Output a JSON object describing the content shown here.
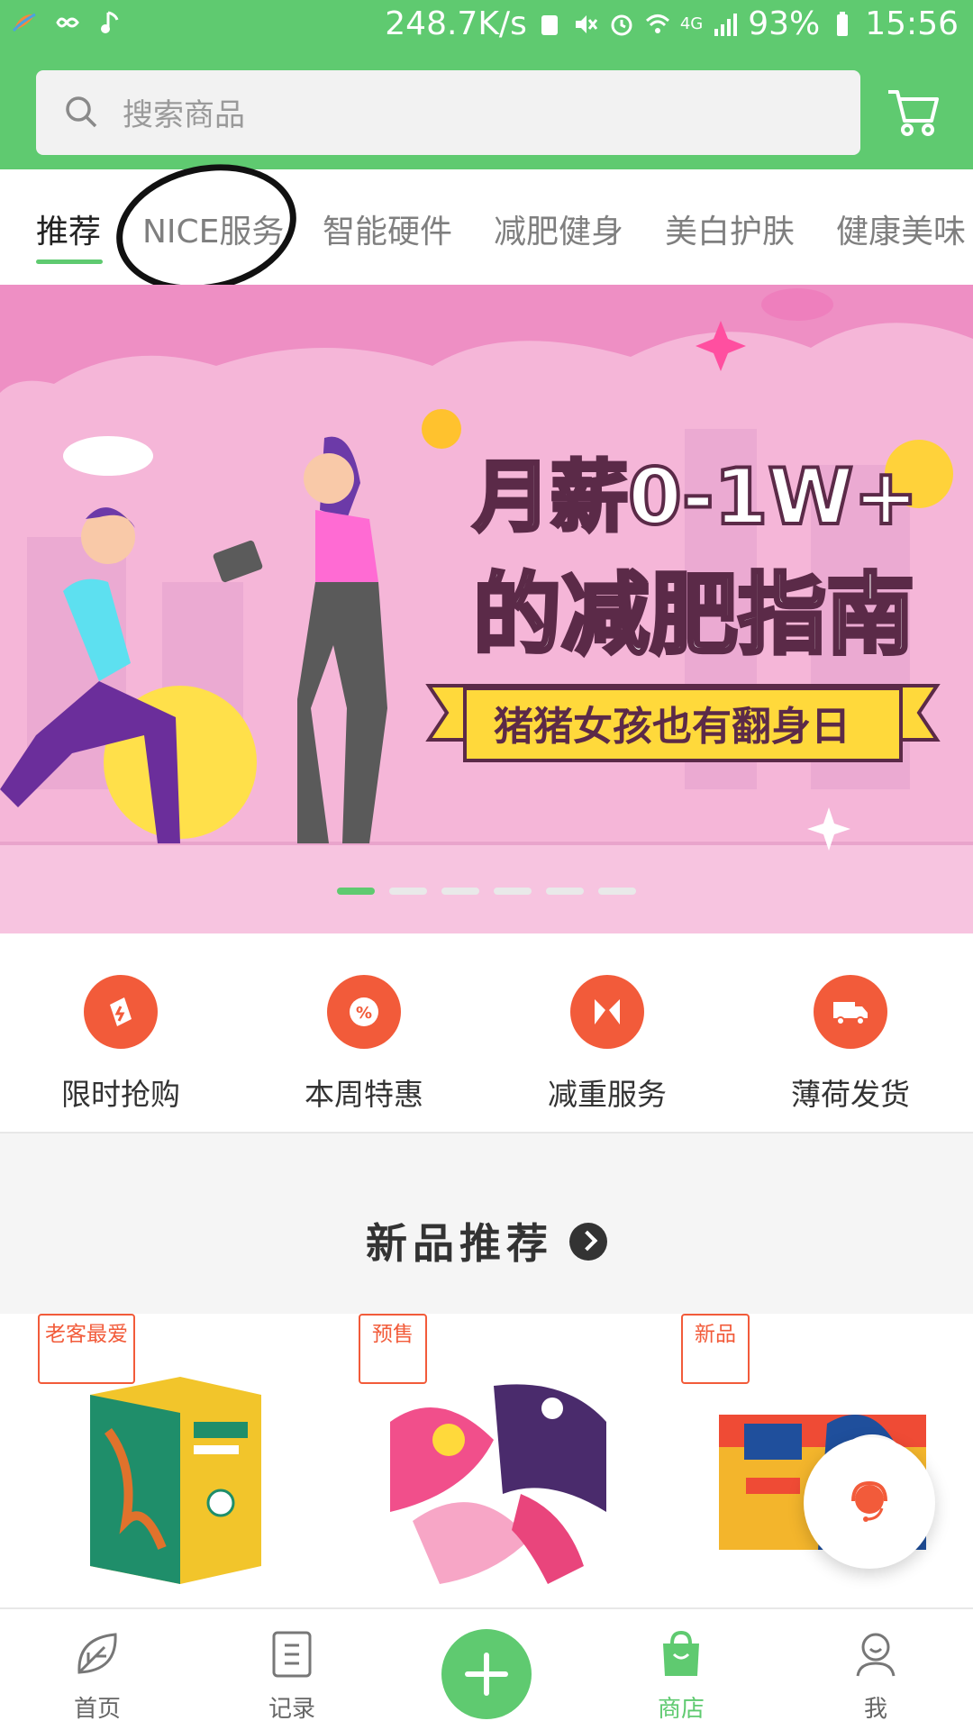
{
  "status_bar": {
    "network_speed": "248.7K/s",
    "network_type": "4G",
    "battery": "93%",
    "time": "15:56",
    "icons": [
      "app-icon",
      "infinity-icon",
      "music-note-icon",
      "battery-saver-icon",
      "mute-icon",
      "alarm-icon",
      "wifi-icon",
      "signal-icon",
      "battery-icon"
    ]
  },
  "header": {
    "search_placeholder": "搜索商品",
    "cart_icon": "cart-icon"
  },
  "tabs": [
    {
      "label": "推荐",
      "active": true
    },
    {
      "label": "NICE服务",
      "active": false
    },
    {
      "label": "智能硬件",
      "active": false
    },
    {
      "label": "减肥健身",
      "active": false
    },
    {
      "label": "美白护肤",
      "active": false
    },
    {
      "label": "健康美味",
      "active": false
    }
  ],
  "banner": {
    "line1": "月薪0-1W+",
    "line2": "的减肥指南",
    "ribbon": "猪猪女孩也有翻身日",
    "slide_count": 6,
    "active_slide": 1
  },
  "quick_actions": [
    {
      "label": "限时抢购",
      "icon": "flash-sale-icon"
    },
    {
      "label": "本周特惠",
      "icon": "percent-icon"
    },
    {
      "label": "减重服务",
      "icon": "service-icon"
    },
    {
      "label": "薄荷发货",
      "icon": "truck-icon"
    }
  ],
  "new_products": {
    "title": "新品推荐",
    "items": [
      {
        "badge": "老客最爱",
        "image": "nutrition-box-product"
      },
      {
        "badge": "预售",
        "image": "flamingo-scale-product"
      },
      {
        "badge": "新品",
        "image": "probiotic-box-product"
      }
    ]
  },
  "fab": {
    "icon": "customer-service-icon"
  },
  "bottom_nav": [
    {
      "label": "首页",
      "icon": "leaf-icon",
      "active": false
    },
    {
      "label": "记录",
      "icon": "notepad-icon",
      "active": false
    },
    {
      "label": "",
      "icon": "plus-icon",
      "active": false
    },
    {
      "label": "商店",
      "icon": "shopping-bag-icon",
      "active": true
    },
    {
      "label": "我",
      "icon": "profile-icon",
      "active": false
    }
  ],
  "colors": {
    "brand_green": "#5fca70",
    "accent_orange": "#f25b3a",
    "banner_pink": "#f5b6d8",
    "ribbon_yellow": "#ffd93b"
  }
}
